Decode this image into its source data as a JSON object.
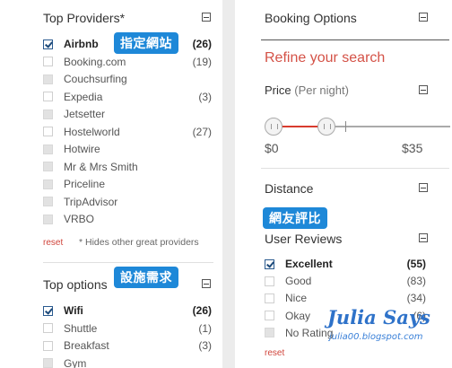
{
  "top_providers": {
    "title": "Top Providers*",
    "badge": "指定網站",
    "items": [
      {
        "label": "Airbnb",
        "count": "(26)",
        "checked": true
      },
      {
        "label": "Booking.com",
        "count": "(19)",
        "checked": false
      },
      {
        "label": "Couchsurfing",
        "count": "",
        "checked": false
      },
      {
        "label": "Expedia",
        "count": "(3)",
        "checked": false
      },
      {
        "label": "Jetsetter",
        "count": "",
        "checked": false
      },
      {
        "label": "Hostelworld",
        "count": "(27)",
        "checked": false
      },
      {
        "label": "Hotwire",
        "count": "",
        "checked": false
      },
      {
        "label": "Mr & Mrs Smith",
        "count": "",
        "checked": false
      },
      {
        "label": "Priceline",
        "count": "",
        "checked": false
      },
      {
        "label": "TripAdvisor",
        "count": "",
        "checked": false
      },
      {
        "label": "VRBO",
        "count": "",
        "checked": false
      }
    ],
    "reset": "reset",
    "note": "* Hides other great providers"
  },
  "top_options": {
    "title": "Top options",
    "badge": "設施需求",
    "items": [
      {
        "label": "Wifi",
        "count": "(26)",
        "checked": true
      },
      {
        "label": "Shuttle",
        "count": "(1)",
        "checked": false
      },
      {
        "label": "Breakfast",
        "count": "(3)",
        "checked": false
      },
      {
        "label": "Gym",
        "count": "",
        "checked": false
      }
    ]
  },
  "booking_options": {
    "title": "Booking Options"
  },
  "refine": {
    "text": "Refine your search"
  },
  "price": {
    "label": "Price",
    "unit": "(Per night)",
    "min_label": "$0",
    "max_label": "$35"
  },
  "distance": {
    "title": "Distance"
  },
  "user_reviews": {
    "title": "User Reviews",
    "badge": "網友評比",
    "items": [
      {
        "label": "Excellent",
        "count": "(55)",
        "checked": true
      },
      {
        "label": "Good",
        "count": "(83)",
        "checked": false
      },
      {
        "label": "Nice",
        "count": "(34)",
        "checked": false
      },
      {
        "label": "Okay",
        "count": "(6)",
        "checked": false
      },
      {
        "label": "No Rating",
        "count": "",
        "checked": false
      }
    ],
    "reset": "reset"
  },
  "watermark": {
    "title": "Julia Says",
    "subtitle": "julia00.blogspot.com"
  },
  "colors": {
    "accent_red": "#d45247",
    "badge_blue": "#1e88d8",
    "checkbox_blue": "#1d4a7a"
  }
}
